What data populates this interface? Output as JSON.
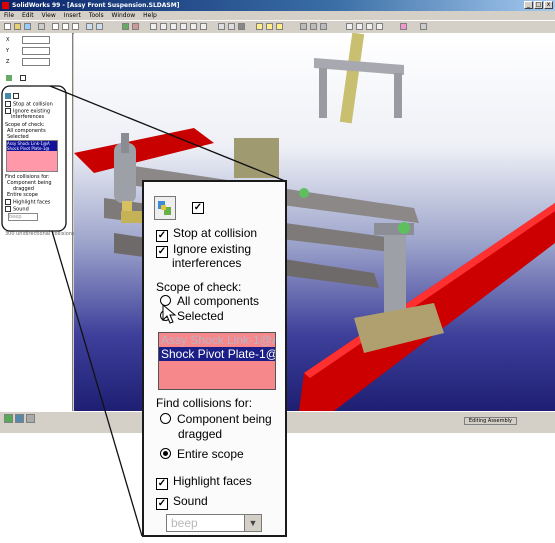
{
  "window": {
    "title": "SolidWorks 99 - [Assy Front Suspension.SLDASM]",
    "controls": [
      "_",
      "□",
      "x"
    ]
  },
  "menu": [
    "File",
    "Edit",
    "View",
    "Insert",
    "Tools",
    "Window",
    "Help"
  ],
  "status": {
    "text": "Editing Assembly"
  },
  "panel": {
    "stop_at_collision": "Stop at collision",
    "ignore_existing_1": "Ignore existing",
    "ignore_existing_2": "interferences",
    "scope_label": "Scope of check:",
    "all_components": "All components",
    "selected": "Selected",
    "list": [
      "Assy Shock Link-1@A",
      "Shock Pivot Plate-1@"
    ],
    "find_collisions_for": "Find collisions for:",
    "component_being_1": "Component being",
    "component_being_2": "dragged",
    "entire_scope": "Entire scope",
    "highlight_faces": "Highlight faces",
    "sound": "Sound",
    "sound_value": "beep",
    "checked_mark": "✓"
  },
  "mini_panel": {
    "x": "X",
    "y": "Y",
    "z": "Z",
    "stop_at_collision": "Stop at collision",
    "ignore_existing": "Ignore existing",
    "interferences": "interferences",
    "scope": "Scope of check:",
    "all_components": "All components",
    "selected": "Selected",
    "find": "Find collisions for:",
    "component": "Component being",
    "dragged": "dragged",
    "entire": "Entire scope",
    "highlight": "Highlight faces",
    "sound": "Sound",
    "beep": "beep",
    "note": "300 unidirectional collisions",
    "list": [
      "Assy Shock Link-1@A",
      "Shock Pivot Plate-1@"
    ]
  },
  "colors": {
    "list_bg": "#f6888c",
    "selected_bg": "#1b1e86",
    "ski_red": "#d40000"
  }
}
